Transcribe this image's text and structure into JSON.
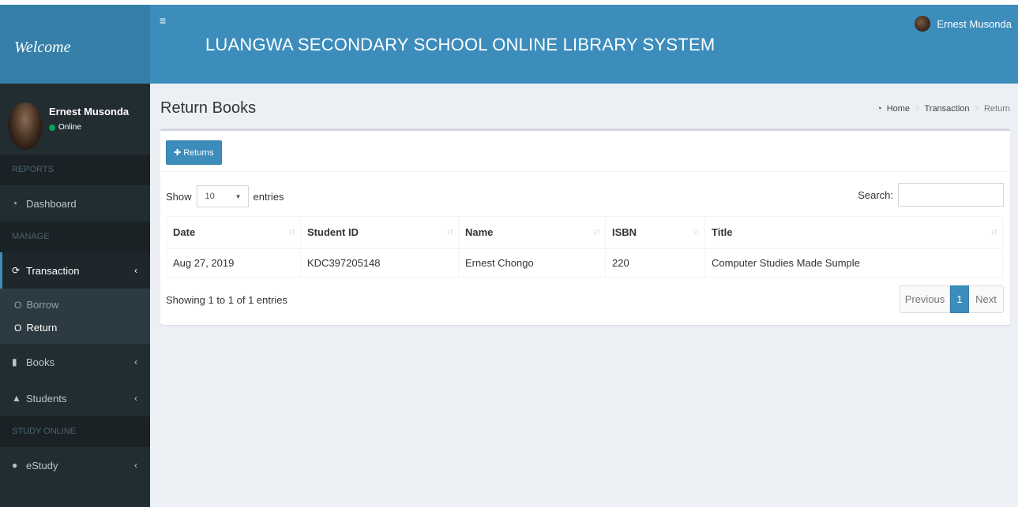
{
  "header": {
    "logo_text": "Welcome",
    "menu_icon": "hamburger-icon",
    "title": "LUANGWA SECONDARY SCHOOL ONLINE LIBRARY SYSTEM",
    "user_name": "Ernest Musonda"
  },
  "sidebar": {
    "user": {
      "name": "Ernest Musonda",
      "status": "Online"
    },
    "sections": {
      "reports": "REPORTS",
      "manage": "MANAGE",
      "study_online": "STUDY ONLINE"
    },
    "items": {
      "dashboard": {
        "label": "Dashboard",
        "icon": "dashboard-icon"
      },
      "transaction": {
        "label": "Transaction",
        "icon": "refresh-icon"
      },
      "books": {
        "label": "Books",
        "icon": "book-icon"
      },
      "students": {
        "label": "Students",
        "icon": "graduation-cap-icon"
      },
      "estudy": {
        "label": "eStudy",
        "icon": "globe-icon"
      }
    },
    "transaction_sub": {
      "borrow": "Borrow",
      "return": "Return"
    }
  },
  "content": {
    "page_title": "Return Books",
    "breadcrumb": {
      "home": "Home",
      "transaction": "Transaction",
      "current": "Return"
    },
    "returns_button": "Returns",
    "show_label": "Show",
    "entries_value": "10",
    "entries_label": "entries",
    "search_label": "Search:",
    "search_value": "",
    "table": {
      "headers": {
        "date": "Date",
        "student_id": "Student ID",
        "name": "Name",
        "isbn": "ISBN",
        "title": "Title"
      },
      "rows": [
        {
          "date": "Aug 27, 2019",
          "student_id": "KDC397205148",
          "name": "Ernest Chongo",
          "isbn": "220",
          "title": "Computer Studies Made Sumple"
        }
      ]
    },
    "info_text": "Showing 1 to 1 of 1 entries",
    "pagination": {
      "previous": "Previous",
      "page": "1",
      "next": "Next"
    }
  },
  "colors": {
    "navbar": "#3c8dbc",
    "logo": "#367fa9",
    "sidebar": "#222d32",
    "online": "#00a65a"
  }
}
